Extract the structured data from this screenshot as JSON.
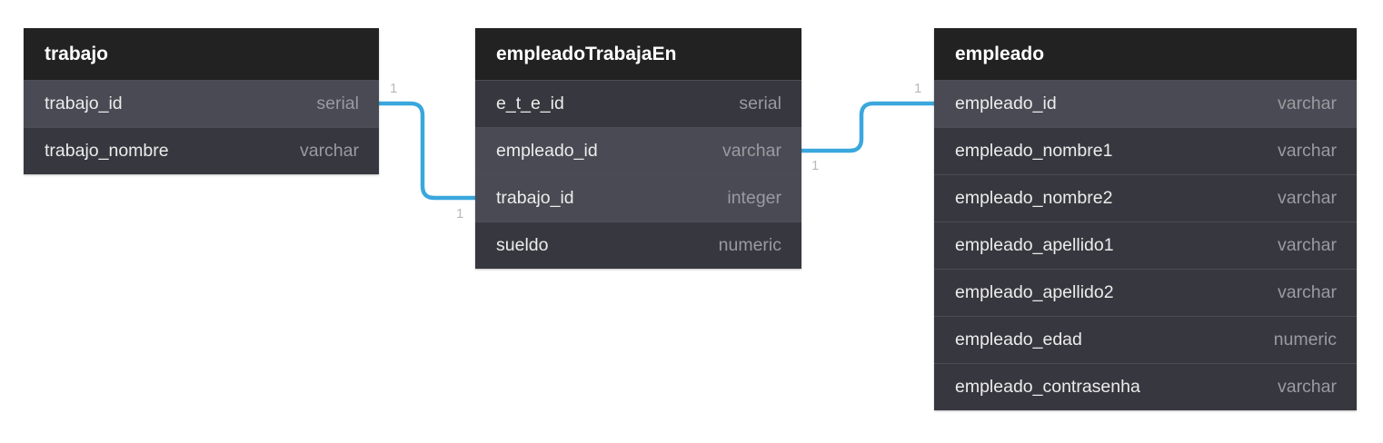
{
  "tables": {
    "trabajo": {
      "title": "trabajo",
      "fields": [
        {
          "name": "trabajo_id",
          "type": "serial"
        },
        {
          "name": "trabajo_nombre",
          "type": "varchar"
        }
      ]
    },
    "empleadoTrabajaEn": {
      "title": "empleadoTrabajaEn",
      "fields": [
        {
          "name": "e_t_e_id",
          "type": "serial"
        },
        {
          "name": "empleado_id",
          "type": "varchar"
        },
        {
          "name": "trabajo_id",
          "type": "integer"
        },
        {
          "name": "sueldo",
          "type": "numeric"
        }
      ]
    },
    "empleado": {
      "title": "empleado",
      "fields": [
        {
          "name": "empleado_id",
          "type": "varchar"
        },
        {
          "name": "empleado_nombre1",
          "type": "varchar"
        },
        {
          "name": "empleado_nombre2",
          "type": "varchar"
        },
        {
          "name": "empleado_apellido1",
          "type": "varchar"
        },
        {
          "name": "empleado_apellido2",
          "type": "varchar"
        },
        {
          "name": "empleado_edad",
          "type": "numeric"
        },
        {
          "name": "empleado_contrasenha",
          "type": "varchar"
        }
      ]
    }
  },
  "relations": [
    {
      "from": "trabajo.trabajo_id",
      "to": "empleadoTrabajaEn.trabajo_id",
      "from_card": "1",
      "to_card": "1"
    },
    {
      "from": "empleadoTrabajaEn.empleado_id",
      "to": "empleado.empleado_id",
      "from_card": "1",
      "to_card": "1"
    }
  ],
  "colors": {
    "connector": "#3aa7dd",
    "header_bg": "#222222",
    "row_bg": "#37373f",
    "row_highlight_bg": "#494a53"
  }
}
